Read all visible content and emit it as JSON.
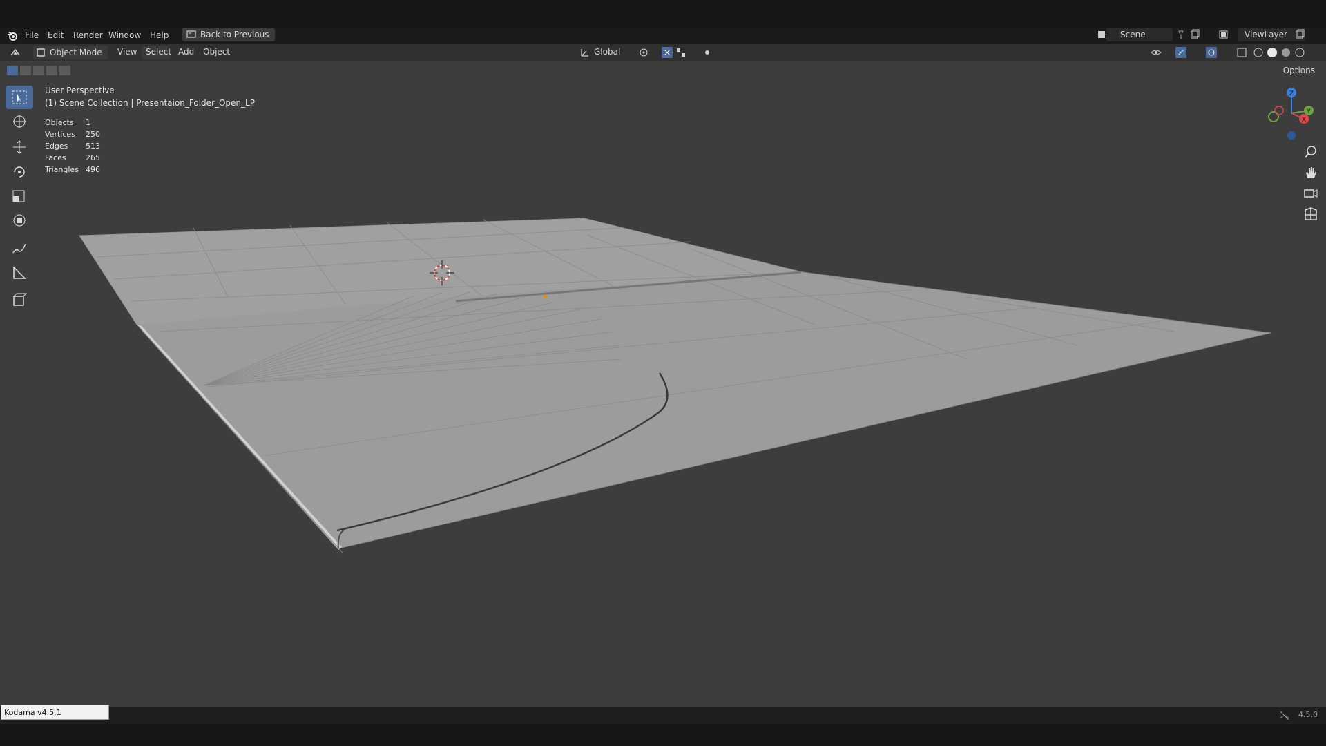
{
  "menubar": {
    "items": [
      "File",
      "Edit",
      "Render",
      "Window",
      "Help"
    ],
    "back_button": "Back to Previous",
    "scene_name": "Scene",
    "view_layer": "ViewLayer"
  },
  "viewport_header": {
    "mode": "Object Mode",
    "menus": [
      "View",
      "Select",
      "Add",
      "Object"
    ],
    "transform_orientation": "Global",
    "options_label": "Options"
  },
  "overlay": {
    "perspective": "User Perspective",
    "collection": "(1) Scene Collection | Presentaion_Folder_Open_LP",
    "stats": [
      {
        "label": "Objects",
        "value": "1"
      },
      {
        "label": "Vertices",
        "value": "250"
      },
      {
        "label": "Edges",
        "value": "513"
      },
      {
        "label": "Faces",
        "value": "265"
      },
      {
        "label": "Triangles",
        "value": "496"
      }
    ]
  },
  "toolbar": {
    "tools": [
      "select-box-icon",
      "cursor-icon",
      "move-icon",
      "rotate-icon",
      "scale-icon",
      "transform-icon",
      "annotate-icon",
      "measure-icon",
      "add-cube-icon"
    ]
  },
  "gizmo": {
    "axes": [
      "Z",
      "Y",
      "X"
    ]
  },
  "statusbar": {
    "addon": "Kodama v4.5.1",
    "version": "4.5.0"
  },
  "colors": {
    "viewport_bg": "#3d3d3d",
    "mesh_face": "#9c9c9c",
    "active_tool": "#4a6a9a",
    "axis_x": "#e0464e",
    "axis_y": "#6ea33f",
    "axis_z": "#3b80d8"
  }
}
